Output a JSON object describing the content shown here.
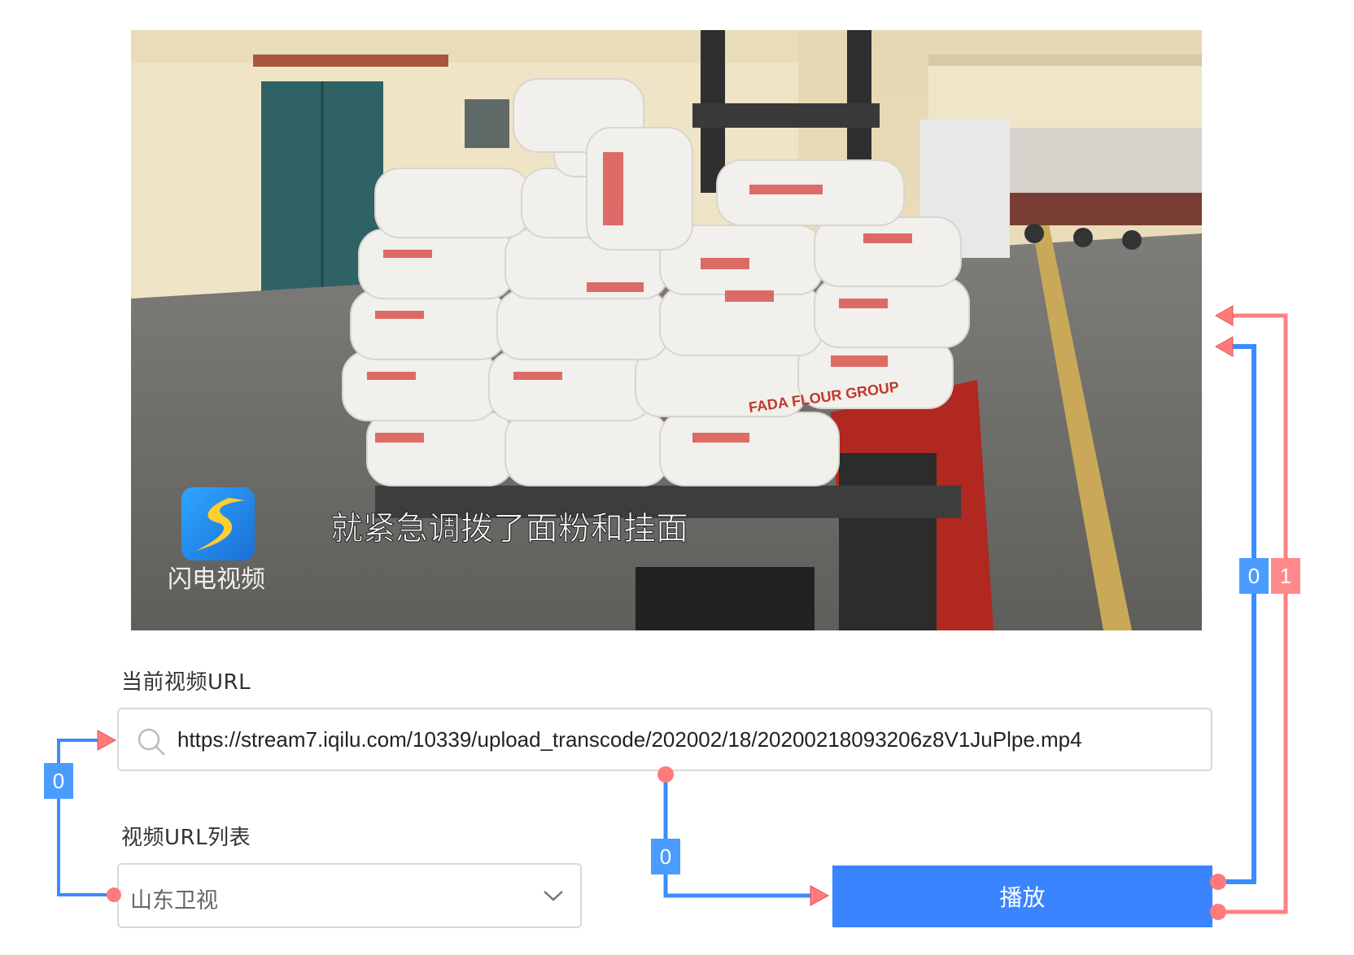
{
  "video": {
    "subtitle": "就紧急调拨了面粉和挂面",
    "logo_text": "闪电视频",
    "bag_print": "FADA FLOUR GROUP"
  },
  "url_field": {
    "label": "当前视频URL",
    "value": "https://stream7.iqilu.com/10339/upload_transcode/202002/18/20200218093206z8V1JuPlpe.mp4",
    "icon": "search-icon"
  },
  "url_list": {
    "label": "视频URL列表",
    "selected": "山东卫视",
    "icon": "chevron-down-icon"
  },
  "play_button": {
    "label": "播放"
  },
  "connections": {
    "badges": [
      "0",
      "0",
      "0",
      "1"
    ],
    "colors": {
      "blue": "#3a8cff",
      "red": "#ff8080"
    }
  },
  "colors": {
    "accent": "#3a84ff"
  }
}
